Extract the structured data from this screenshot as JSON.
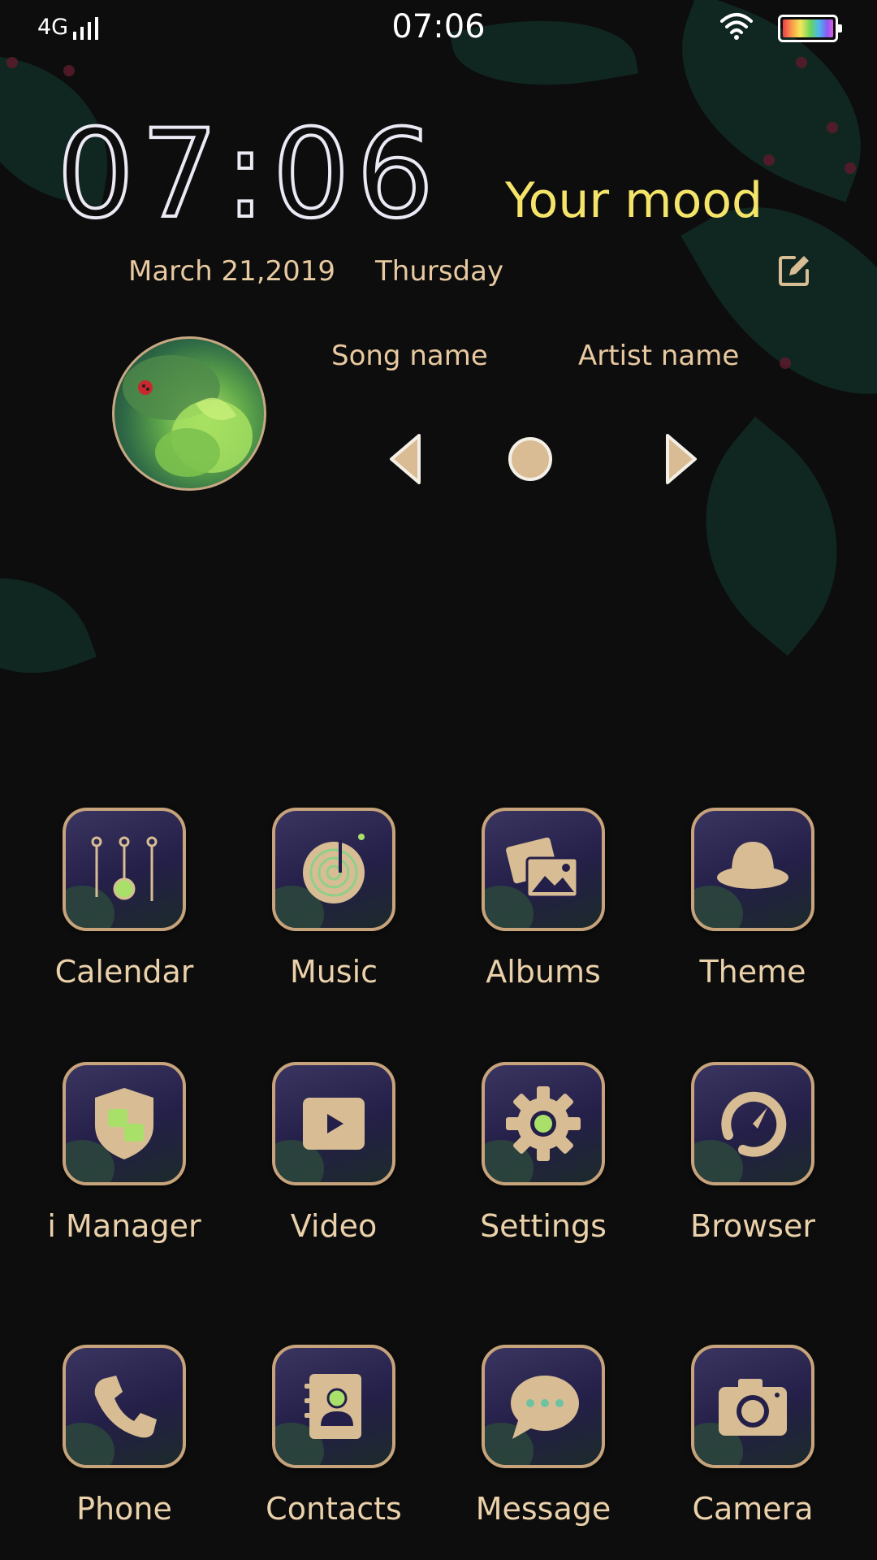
{
  "status_bar": {
    "network": "4G",
    "time": "07:06",
    "icons": [
      "signal-icon",
      "wifi-icon",
      "battery-icon"
    ]
  },
  "clock_widget": {
    "time": "07:06",
    "mood": "Your mood",
    "date": "March 21,2019",
    "weekday": "Thursday",
    "edit_icon": "edit-icon"
  },
  "music_widget": {
    "song": "Song name",
    "artist": "Artist name",
    "controls": [
      "previous-icon",
      "play-pause-icon",
      "next-icon"
    ]
  },
  "apps": [
    {
      "label": "Calendar",
      "icon": "calendar-icon"
    },
    {
      "label": "Music",
      "icon": "music-icon"
    },
    {
      "label": "Albums",
      "icon": "albums-icon"
    },
    {
      "label": "Theme",
      "icon": "theme-icon"
    },
    {
      "label": "i Manager",
      "icon": "shield-icon"
    },
    {
      "label": "Video",
      "icon": "video-icon"
    },
    {
      "label": "Settings",
      "icon": "gear-icon"
    },
    {
      "label": "Browser",
      "icon": "compass-icon"
    },
    {
      "label": "Phone",
      "icon": "phone-icon"
    },
    {
      "label": "Contacts",
      "icon": "contacts-icon"
    },
    {
      "label": "Message",
      "icon": "message-icon"
    },
    {
      "label": "Camera",
      "icon": "camera-icon"
    }
  ],
  "colors": {
    "accent_gold": "#c6a37a",
    "mood_yellow": "#f4e46a",
    "tile_purple": "#2a2550",
    "background": "#0d0d0e"
  }
}
